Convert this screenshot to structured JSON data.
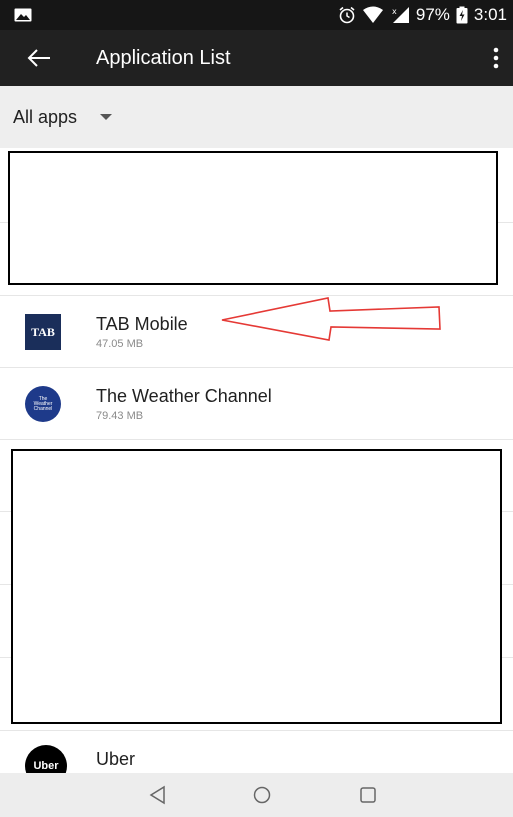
{
  "status_bar": {
    "battery": "97%",
    "time": "3:01",
    "icons": [
      "gallery-icon",
      "alarm-icon",
      "wifi-icon",
      "signal-icon",
      "battery-icon"
    ]
  },
  "app_bar": {
    "title": "Application List",
    "icons": [
      "back-arrow-icon",
      "more-vert-icon"
    ]
  },
  "filter": {
    "label": "All apps"
  },
  "apps": [
    {
      "name": "TAB Mobile",
      "size": "47.05 MB",
      "logo_text": "TAB",
      "logo_color": "#1a2e5a"
    },
    {
      "name": "The Weather Channel",
      "size": "79.43 MB",
      "logo_lines": [
        "The",
        "Weather",
        "Channel"
      ],
      "logo_color": "#1e3a8a"
    },
    {
      "name": "Uber",
      "size": "",
      "logo_text": "Uber",
      "logo_color": "#000000"
    }
  ],
  "annotation": {
    "arrow_color": "#e53935"
  },
  "nav_bar": {
    "icons": [
      "back-triangle-icon",
      "home-circle-icon",
      "recents-square-icon"
    ]
  }
}
